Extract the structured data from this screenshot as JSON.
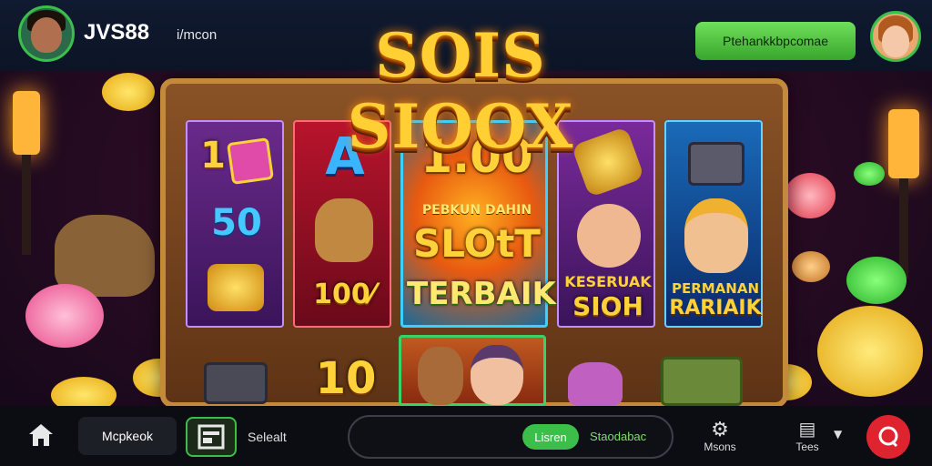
{
  "header": {
    "brand": "JVS88",
    "subtitle": "i/mcon",
    "cta_label": "Ptehankkbpcomae"
  },
  "game": {
    "title": "SOIS SIOOX",
    "reels": {
      "r1_top": "1",
      "r1_mid": "50",
      "r2_top": "A",
      "r2_bottom": "100⁄",
      "center_big": "1.00",
      "center_line1": "PEBKUN DAHIN",
      "center_line2": "SLOtT",
      "center_line3": "TERBAIK",
      "r4_text1": "KESERUAK",
      "r4_text2": "SIOH",
      "r5_text1": "PERMANAN",
      "r5_text2": "RARIAIK",
      "bottom_left": "10"
    }
  },
  "bottombar": {
    "home_label": "",
    "mcp_label": "Mcpkeok",
    "select_label": "Selealt",
    "search_btn": "Lisren",
    "search_text": "Staodabac",
    "menu_label": "Msons",
    "tees_label": "Tees"
  },
  "colors": {
    "accent_green": "#3bbf4a",
    "gold": "#ffd23a",
    "danger_red": "#e0242f"
  }
}
